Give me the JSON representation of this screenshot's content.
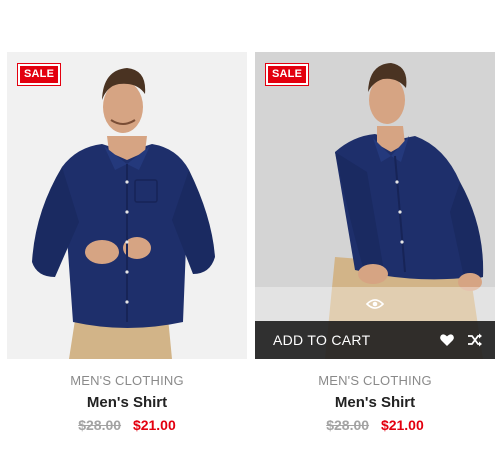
{
  "products": [
    {
      "badge": "SALE",
      "category": "MEN'S CLOTHING",
      "name": "Men's Shirt",
      "old_price": "$28.00",
      "price": "$21.00"
    },
    {
      "badge": "SALE",
      "category": "MEN'S CLOTHING",
      "name": "Men's Shirt",
      "old_price": "$28.00",
      "price": "$21.00",
      "actions": {
        "add_to_cart": "ADD TO CART",
        "icons": [
          "eye-icon",
          "heart-icon",
          "shuffle-icon"
        ]
      }
    }
  ],
  "colors": {
    "sale": "#e3000f",
    "shirt": "#1e2f6b",
    "pants": "#d2b488",
    "bar": "#222222"
  }
}
